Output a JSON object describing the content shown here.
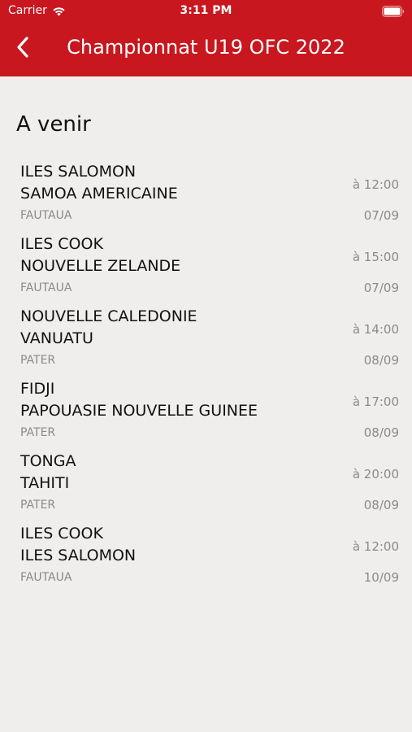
{
  "status_bar": {
    "carrier": "Carrier",
    "time": "3:11 PM",
    "wifi_icon": "wifi-icon",
    "battery_icon": "battery-icon"
  },
  "header": {
    "title": "Championnat U19 OFC 2022",
    "back_icon": "chevron-left-icon",
    "background_color": "#c8171e"
  },
  "section": {
    "title": "A venir"
  },
  "matches": [
    {
      "home": "ILES SALOMON",
      "away": "SAMOA AMERICAINE",
      "venue": "FAUTAUA",
      "time": "à 12:00",
      "date": "07/09"
    },
    {
      "home": "ILES COOK",
      "away": "NOUVELLE ZELANDE",
      "venue": "FAUTAUA",
      "time": "à 15:00",
      "date": "07/09"
    },
    {
      "home": "NOUVELLE CALEDONIE",
      "away": "VANUATU",
      "venue": "PATER",
      "time": "à 14:00",
      "date": "08/09"
    },
    {
      "home": "FIDJI",
      "away": "PAPOUASIE NOUVELLE GUINEE",
      "venue": "PATER",
      "time": "à 17:00",
      "date": "08/09"
    },
    {
      "home": "TONGA",
      "away": "TAHITI",
      "venue": "PATER",
      "time": "à 20:00",
      "date": "08/09"
    },
    {
      "home": "ILES COOK",
      "away": "ILES SALOMON",
      "venue": "FAUTAUA",
      "time": "à 12:00",
      "date": "10/09"
    }
  ]
}
